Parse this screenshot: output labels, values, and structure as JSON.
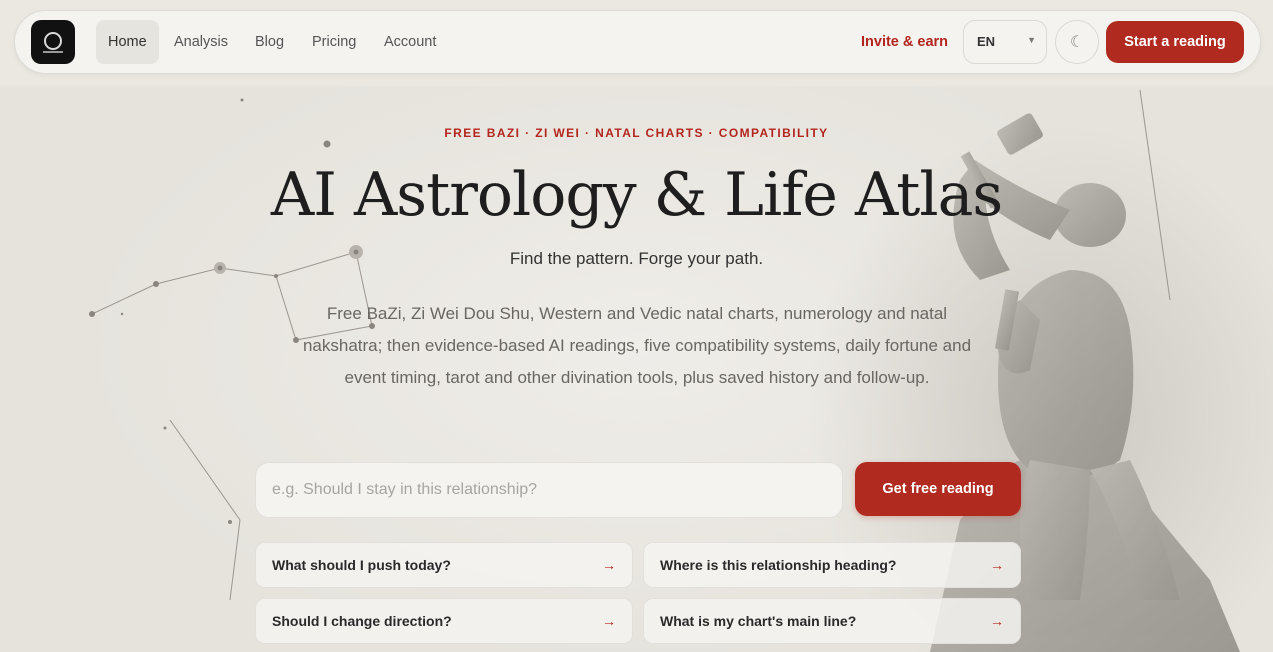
{
  "nav": {
    "logo_icon": "logo-mark",
    "links": [
      "Home",
      "Analysis",
      "Blog",
      "Pricing",
      "Account"
    ],
    "active": "Home",
    "invite": "Invite & earn",
    "language": "EN",
    "theme_icon": "moon-icon",
    "cta": "Start a reading"
  },
  "hero": {
    "eyebrow": "FREE BAZI · ZI WEI · NATAL CHARTS · COMPATIBILITY",
    "title": "AI Astrology & Life Atlas",
    "tagline": "Find the pattern. Forge your path.",
    "description": "Free BaZi, Zi Wei Dou Shu, Western and Vedic natal charts, numerology and natal nakshatra; then evidence-based AI readings, five compatibility systems, daily fortune and event timing, tarot and other divination tools, plus saved history and follow-up."
  },
  "search": {
    "placeholder": "e.g. Should I stay in this relationship?",
    "button": "Get free reading"
  },
  "suggestions": [
    "What should I push today?",
    "Where is this relationship heading?",
    "Should I change direction?",
    "What is my chart's main line?"
  ],
  "colors": {
    "accent": "#b12a20",
    "background": "#ebe8e2"
  }
}
